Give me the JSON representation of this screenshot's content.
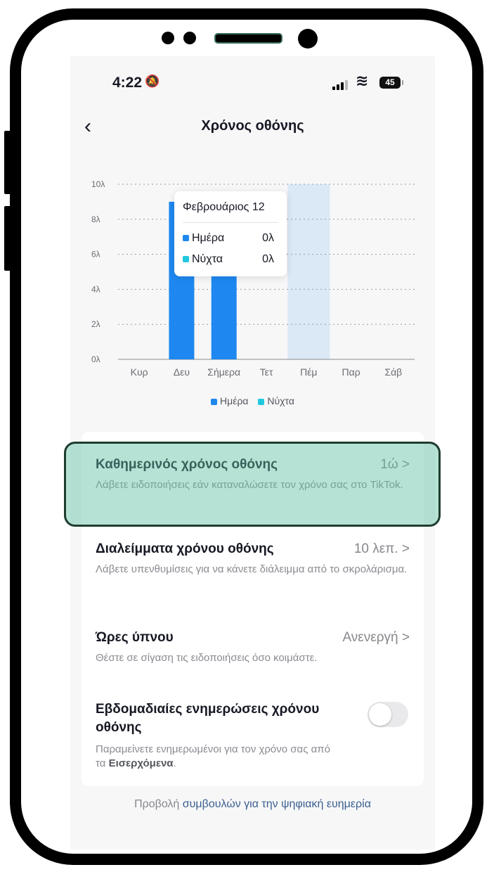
{
  "status_bar": {
    "time": "4:22",
    "battery": "45"
  },
  "nav": {
    "title": "Χρόνος οθόνης",
    "back_icon": "chevron-left-icon"
  },
  "chart_data": {
    "type": "bar",
    "categories": [
      "Κυρ",
      "Δευ",
      "Σήμερα",
      "Τετ",
      "Πέμ",
      "Παρ",
      "Σάβ"
    ],
    "series": [
      {
        "name": "Ημέρα",
        "color": "#1e88f0",
        "values": [
          0,
          9,
          8,
          0,
          0,
          0,
          0
        ]
      },
      {
        "name": "Νύχτα",
        "color": "#20c8e0",
        "values": [
          0,
          0,
          0,
          0,
          0,
          0,
          0
        ]
      }
    ],
    "selected_category": "Πέμ",
    "selected_color": "#dbe8f5",
    "y_ticks": [
      "0λ",
      "2λ",
      "4λ",
      "6λ",
      "8λ",
      "10λ"
    ],
    "ylim": [
      0,
      10
    ],
    "grid": true,
    "legend": "bottom",
    "tooltip": {
      "title": "Φεβρουάριος 12",
      "rows": [
        {
          "label": "Ημέρα",
          "value": "0λ"
        },
        {
          "label": "Νύχτα",
          "value": "0λ"
        }
      ]
    }
  },
  "settings": [
    {
      "title": "Καθημερινός χρόνος οθόνης",
      "value": "1ώ",
      "subtitle": "Λάβετε ειδοποιήσεις εάν καταναλώσετε τον χρόνο σας στο TikTok."
    },
    {
      "title": "Διαλείμματα χρόνου οθόνης",
      "value": "10 λεπ.",
      "subtitle": "Λάβετε υπενθυμίσεις για να κάνετε διάλειμμα από το σκρολάρισμα."
    },
    {
      "title": "Ώρες ύπνου",
      "value": "Ανενεργή",
      "subtitle": "Θέστε σε σίγαση τις ειδοποιήσεις όσο κοιμάστε."
    },
    {
      "title": "Εβδομαδιαίες ενημερώσεις χρόνου οθόνης",
      "subtitle_pre": "Παραμείνετε ενημερωμένοι για τον χρόνο σας από τα ",
      "subtitle_bold": "Εισερχόμενα",
      "subtitle_post": ".",
      "toggle_on": false
    }
  ],
  "chevron": ">",
  "footer": {
    "prefix": "Προβολή ",
    "link": "συμβουλών για την ψηφιακή ευημερία"
  }
}
